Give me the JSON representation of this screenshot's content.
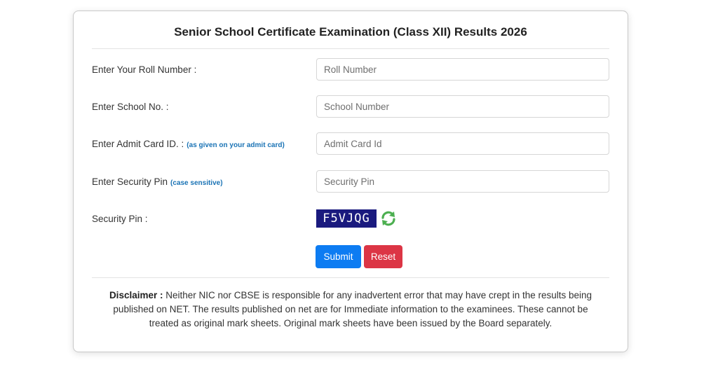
{
  "page_title": "Senior School Certificate Examination (Class XII) Results 2026",
  "fields": {
    "roll": {
      "label": "Enter Your Roll Number :",
      "placeholder": "Roll Number",
      "value": ""
    },
    "school": {
      "label": "Enter School No. :",
      "placeholder": "School Number",
      "value": ""
    },
    "admit": {
      "label": "Enter Admit Card ID. :",
      "hint": "(as given on your admit card)",
      "placeholder": "Admit Card Id",
      "value": ""
    },
    "pin": {
      "label": "Enter Security Pin",
      "hint": "(case sensitive)",
      "placeholder": "Security Pin",
      "value": ""
    }
  },
  "captcha": {
    "label": "Security Pin :",
    "code": "F5VJQG",
    "refresh_icon": "refresh-icon",
    "box_color": "#1a1a7e",
    "icon_color": "#4caf50"
  },
  "buttons": {
    "submit_label": "Submit",
    "reset_label": "Reset",
    "submit_color": "#0d7cf2",
    "reset_color": "#dc3545"
  },
  "disclaimer": {
    "heading": "Disclaimer :",
    "text": "Neither NIC nor CBSE is responsible for any inadvertent error that may have crept in the results being published on NET. The results published on net are for Immediate information to the examinees. These cannot be treated as original mark sheets. Original mark sheets have been issued by the Board separately."
  }
}
